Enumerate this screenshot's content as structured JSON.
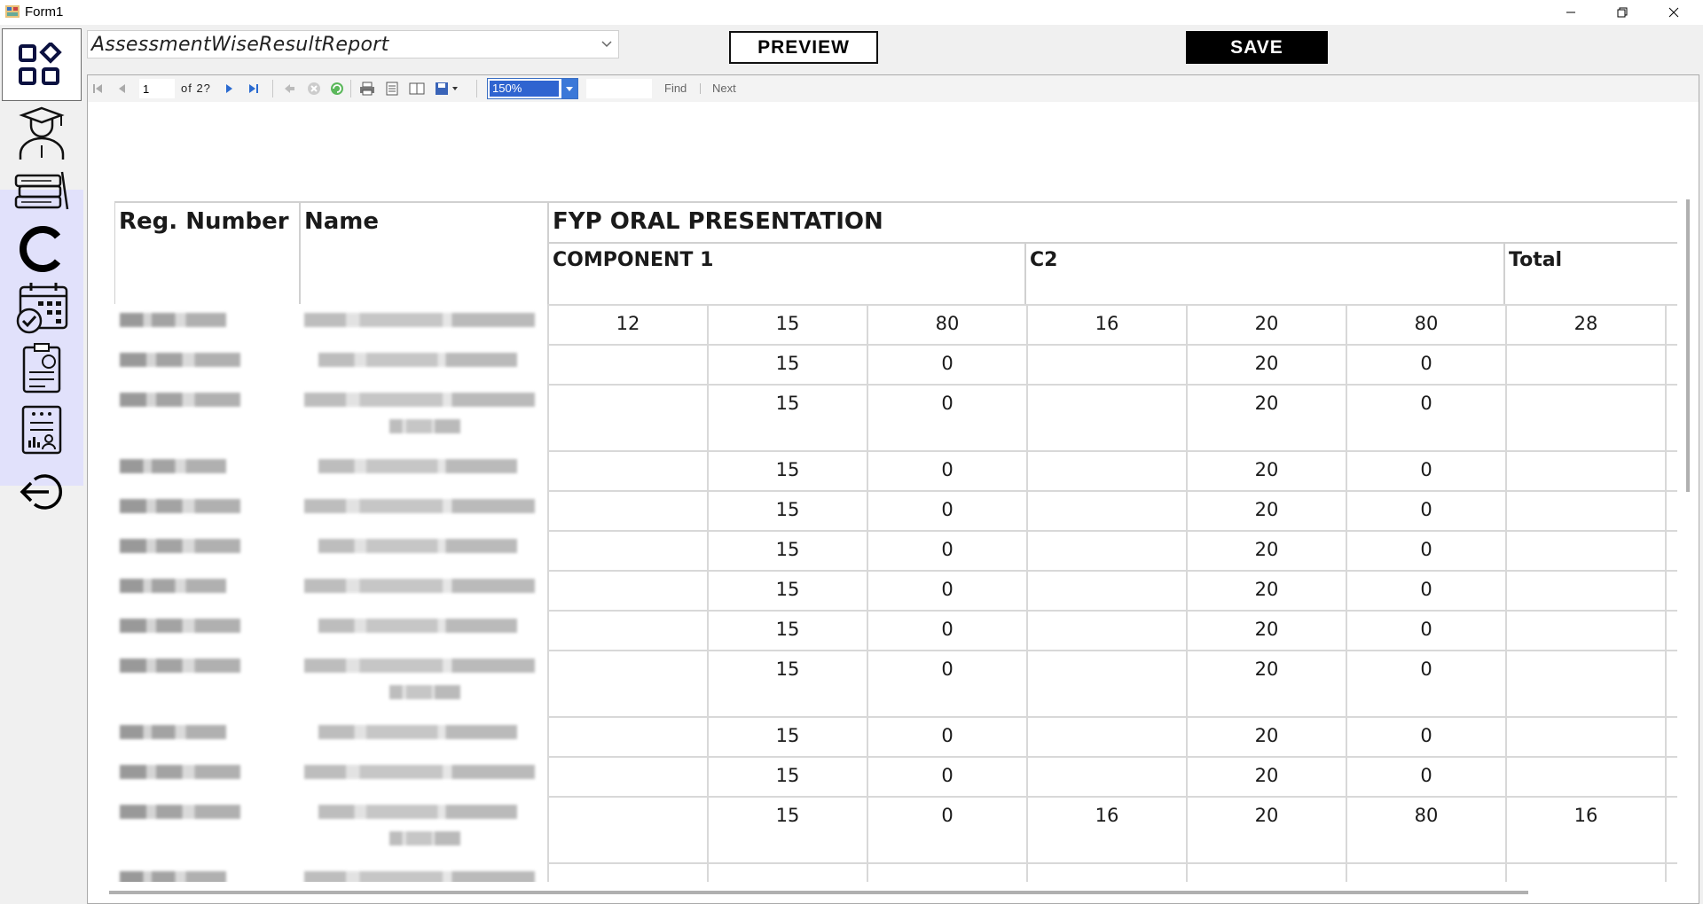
{
  "window": {
    "title": "Form1"
  },
  "sidebar": {
    "items": [
      {
        "name": "dashboard"
      },
      {
        "name": "students"
      },
      {
        "name": "courses"
      },
      {
        "name": "clos"
      },
      {
        "name": "attendance"
      },
      {
        "name": "assessments"
      },
      {
        "name": "reports"
      },
      {
        "name": "logout"
      }
    ]
  },
  "header": {
    "report_select": "AssessmentWiseResultReport",
    "preview_label": "PREVIEW",
    "save_label": "SAVE"
  },
  "viewer": {
    "page": "1",
    "of_text": "of 2?",
    "zoom": "150%",
    "find_label": "Find",
    "next_label": "Next"
  },
  "report": {
    "headers": {
      "reg": "Reg. Number",
      "name": "Name",
      "assessment": "FYP ORAL PRESENTATION",
      "component1": "COMPONENT 1",
      "component2": "C2",
      "total": "Total"
    },
    "rows": [
      [
        "12",
        "15",
        "80",
        "16",
        "20",
        "80",
        "28"
      ],
      [
        "",
        "15",
        "0",
        "",
        "20",
        "0",
        ""
      ],
      [
        "",
        "15",
        "0",
        "",
        "20",
        "0",
        ""
      ],
      [
        "",
        "15",
        "0",
        "",
        "20",
        "0",
        ""
      ],
      [
        "",
        "15",
        "0",
        "",
        "20",
        "0",
        ""
      ],
      [
        "",
        "15",
        "0",
        "",
        "20",
        "0",
        ""
      ],
      [
        "",
        "15",
        "0",
        "",
        "20",
        "0",
        ""
      ],
      [
        "",
        "15",
        "0",
        "",
        "20",
        "0",
        ""
      ],
      [
        "",
        "15",
        "0",
        "",
        "20",
        "0",
        ""
      ],
      [
        "",
        "15",
        "0",
        "",
        "20",
        "0",
        ""
      ],
      [
        "",
        "15",
        "0",
        "",
        "20",
        "0",
        ""
      ],
      [
        "",
        "15",
        "0",
        "16",
        "20",
        "80",
        "16"
      ]
    ]
  }
}
